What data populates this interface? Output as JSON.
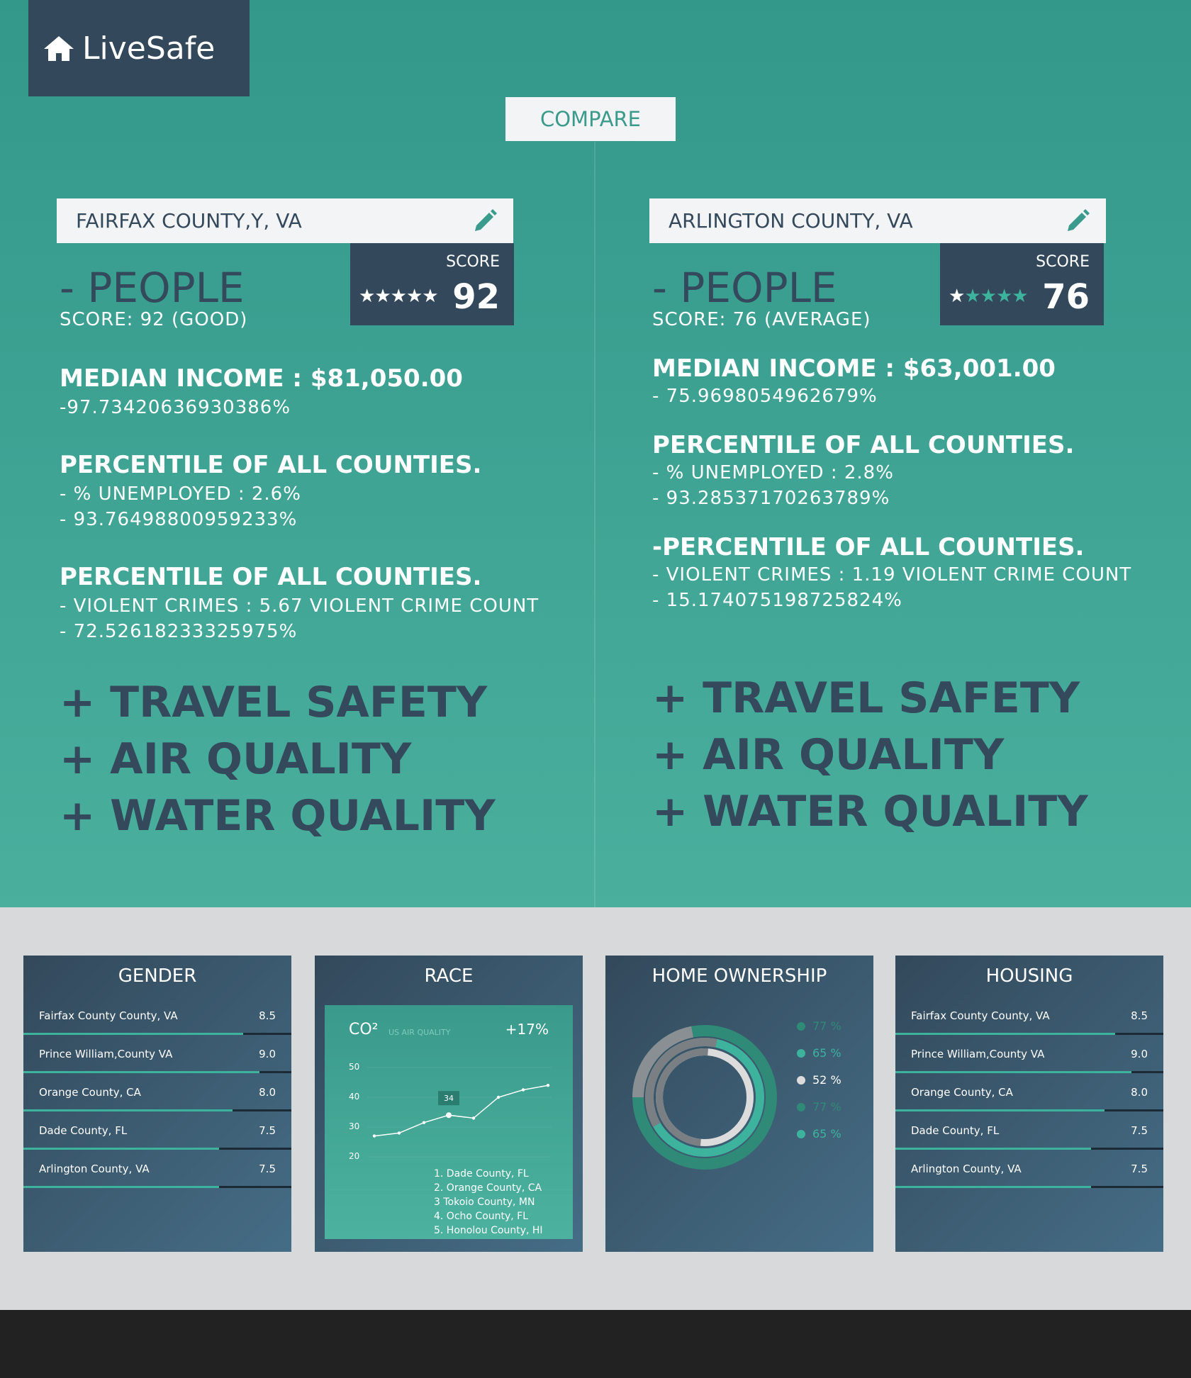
{
  "app": {
    "name": "LiveSafe"
  },
  "compare_button": "COMPARE",
  "left": {
    "county": "FAIRFAX COUNTY,Y, VA",
    "score_label": "SCORE",
    "score": "92",
    "stars_rating": 5,
    "people_title": "- PEOPLE",
    "people_score": "SCORE:  92  (GOOD)",
    "income_title": "MEDIAN INCOME : $81,050.00",
    "income_line": "-97.73420636930386%",
    "pct1_title": "PERCENTILE OF ALL COUNTIES.",
    "pct1_line1": "-  %  UNEMPLOYED  :  2.6%",
    "pct1_line2": "-  93.76498800959233%",
    "pct2_title": "PERCENTILE OF ALL COUNTIES.",
    "pct2_line1": "-  VIOLENT  CRIMES  :  5.67  VIOLENT  CRIME  COUNT",
    "pct2_line2": "-  72.52618233325975%",
    "travel": "+ TRAVEL SAFETY",
    "air": "+ AIR QUALITY",
    "water": "+ WATER QUALITY"
  },
  "right": {
    "county": "ARLINGTON COUNTY, VA",
    "score_label": "SCORE",
    "score": "76",
    "stars_rating": 1,
    "people_title": "- PEOPLE",
    "people_score": "SCORE:  76  (AVERAGE)",
    "income_title": "MEDIAN INCOME : $63,001.00",
    "income_line": "-  75.9698054962679%",
    "pct1_title": "PERCENTILE OF ALL COUNTIES.",
    "pct1_line1": "-  %  UNEMPLOYED  :  2.8%",
    "pct1_line2": "-  93.28537170263789%",
    "pct2_title": "-PERCENTILE OF ALL COUNTIES.",
    "pct2_line1": "-  VIOLENT  CRIMES  :  1.19  VIOLENT  CRIME  COUNT",
    "pct2_line2": "-  15.174075198725824%",
    "travel": "+ TRAVEL SAFETY",
    "air": "+ AIR QUALITY",
    "water": "+ WATER QUALITY"
  },
  "gender": {
    "title": "GENDER",
    "rows": [
      {
        "name": "Fairfax County County, VA",
        "value": "8.5",
        "fill": 0.82
      },
      {
        "name": "Prince William,County VA",
        "value": "9.0",
        "fill": 0.88
      },
      {
        "name": "Orange County, CA",
        "value": "8.0",
        "fill": 0.78
      },
      {
        "name": "Dade County, FL",
        "value": "7.5",
        "fill": 0.73
      },
      {
        "name": "Arlington County, VA",
        "value": "7.5",
        "fill": 0.73
      }
    ]
  },
  "race": {
    "title": "RACE",
    "co2": "CO²",
    "subtitle": "US AIR QUALITY",
    "change": "+17%",
    "ticks": [
      "50",
      "40",
      "30",
      "20"
    ],
    "highlight_label": "34",
    "list": [
      "1.  Dade County, FL",
      "2.  Orange County, CA",
      "3   Tokoio County, MN",
      "4.  Ocho County, FL",
      "5.  Honolou County, HI"
    ]
  },
  "home_ownership": {
    "title": "HOME OWNERSHIP",
    "legend": [
      {
        "label": "77 %",
        "color": "#2f8a78"
      },
      {
        "label": "65 %",
        "color": "#3db39e"
      },
      {
        "label": "52 %",
        "color": "#dcdcdc"
      },
      {
        "label": "77 %",
        "color": "#2f8a78"
      },
      {
        "label": "65 %",
        "color": "#3db39e"
      }
    ]
  },
  "housing": {
    "title": "HOUSING",
    "rows": [
      {
        "name": "Fairfax County County, VA",
        "value": "8.5",
        "fill": 0.82
      },
      {
        "name": "Prince William,County VA",
        "value": "9.0",
        "fill": 0.88
      },
      {
        "name": "Orange County, CA",
        "value": "8.0",
        "fill": 0.78
      },
      {
        "name": "Dade County, FL",
        "value": "7.5",
        "fill": 0.73
      },
      {
        "name": "Arlington County, VA",
        "value": "7.5",
        "fill": 0.73
      }
    ]
  },
  "colors": {
    "teal": "#3a9a8c",
    "navy": "#33495b",
    "accent": "#3db39e"
  },
  "chart_data": {
    "type": "line",
    "x": [
      1,
      2,
      3,
      4,
      5,
      6,
      7,
      8
    ],
    "values": [
      27,
      28,
      31.5,
      34,
      33,
      40,
      42.5,
      44
    ],
    "ylim": [
      20,
      50
    ],
    "highlight_index": 3
  }
}
